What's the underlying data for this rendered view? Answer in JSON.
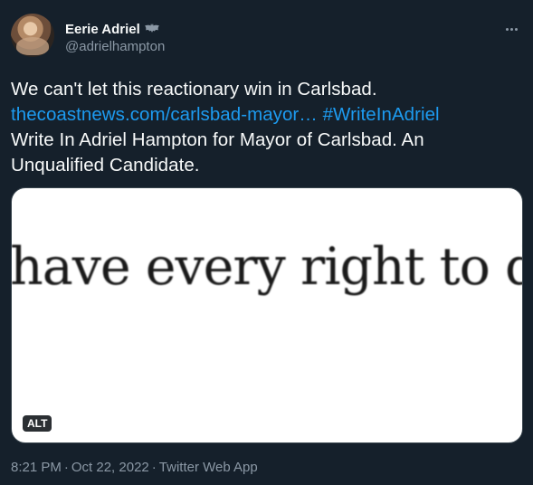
{
  "author": {
    "display_name": "Eerie Adriel",
    "name_emoji": "bat-emoji",
    "handle": "@adrielhampton",
    "avatar": "avatar-photo"
  },
  "tweet": {
    "line1": "We can't let this reactionary win in Carlsbad.",
    "link_url_text": "thecoastnews.com/carlsbad-mayor…",
    "hashtag": "#WriteInAdriel",
    "line3": "Write In Adriel Hampton for Mayor of Carlsbad. An",
    "line4": "Unqualified Candidate."
  },
  "media": {
    "image_text": "have every right to dete",
    "alt_badge": "ALT"
  },
  "meta": {
    "time": "8:21 PM",
    "separator": "·",
    "date": "Oct 22, 2022",
    "source": "Twitter Web App"
  },
  "icons": {
    "more": "more-horizontal-icon"
  },
  "colors": {
    "background": "#15202b",
    "text": "#f7f9f9",
    "secondary": "#8b98a5",
    "link": "#1d9bf0",
    "media_bg": "#ffffff"
  }
}
